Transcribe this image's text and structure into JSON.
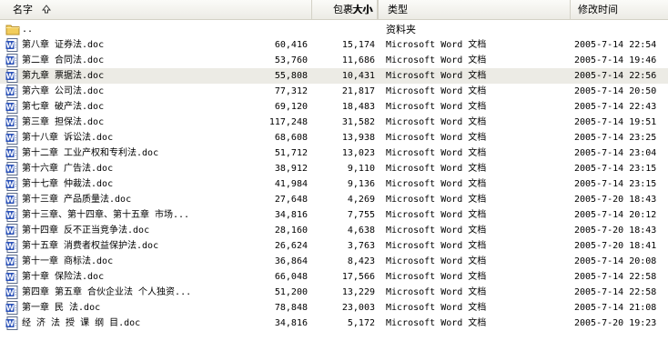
{
  "columns": {
    "name": "名字",
    "size": "大小",
    "packed_size": "包裹大小",
    "type": "类型",
    "modified": "修改时间"
  },
  "parent_row": {
    "name": "..",
    "type": "资料夹"
  },
  "files": [
    {
      "name": "第八章 证券法.doc",
      "size": "60,416",
      "packed": "15,174",
      "type": "Microsoft Word 文档",
      "date": "2005-7-14 22:54"
    },
    {
      "name": "第二章 合同法.doc",
      "size": "53,760",
      "packed": "11,686",
      "type": "Microsoft Word 文档",
      "date": "2005-7-14 19:46"
    },
    {
      "name": "第九章 票据法.doc",
      "size": "55,808",
      "packed": "10,431",
      "type": "Microsoft Word 文档",
      "date": "2005-7-14 22:56"
    },
    {
      "name": "第六章 公司法.doc",
      "size": "77,312",
      "packed": "21,817",
      "type": "Microsoft Word 文档",
      "date": "2005-7-14 20:50"
    },
    {
      "name": "第七章 破产法.doc",
      "size": "69,120",
      "packed": "18,483",
      "type": "Microsoft Word 文档",
      "date": "2005-7-14 22:43"
    },
    {
      "name": "第三章 担保法.doc",
      "size": "117,248",
      "packed": "31,582",
      "type": "Microsoft Word 文档",
      "date": "2005-7-14 19:51"
    },
    {
      "name": "第十八章 诉讼法.doc",
      "size": "68,608",
      "packed": "13,938",
      "type": "Microsoft Word 文档",
      "date": "2005-7-14 23:25"
    },
    {
      "name": "第十二章 工业产权和专利法.doc",
      "size": "51,712",
      "packed": "13,023",
      "type": "Microsoft Word 文档",
      "date": "2005-7-14 23:04"
    },
    {
      "name": "第十六章 广告法.doc",
      "size": "38,912",
      "packed": "9,110",
      "type": "Microsoft Word 文档",
      "date": "2005-7-14 23:15"
    },
    {
      "name": "第十七章 仲裁法.doc",
      "size": "41,984",
      "packed": "9,136",
      "type": "Microsoft Word 文档",
      "date": "2005-7-14 23:15"
    },
    {
      "name": "第十三章 产品质量法.doc",
      "size": "27,648",
      "packed": "4,269",
      "type": "Microsoft Word 文档",
      "date": "2005-7-20 18:43"
    },
    {
      "name": "第十三章、第十四章、第十五章 市场...",
      "size": "34,816",
      "packed": "7,755",
      "type": "Microsoft Word 文档",
      "date": "2005-7-14 20:12"
    },
    {
      "name": "第十四章 反不正当竞争法.doc",
      "size": "28,160",
      "packed": "4,638",
      "type": "Microsoft Word 文档",
      "date": "2005-7-20 18:43"
    },
    {
      "name": "第十五章 消费者权益保护法.doc",
      "size": "26,624",
      "packed": "3,763",
      "type": "Microsoft Word 文档",
      "date": "2005-7-20 18:41"
    },
    {
      "name": "第十一章 商标法.doc",
      "size": "36,864",
      "packed": "8,423",
      "type": "Microsoft Word 文档",
      "date": "2005-7-14 20:08"
    },
    {
      "name": "第十章 保险法.doc",
      "size": "66,048",
      "packed": "17,566",
      "type": "Microsoft Word 文档",
      "date": "2005-7-14 22:58"
    },
    {
      "name": "第四章 第五章 合伙企业法 个人独资...",
      "size": "51,200",
      "packed": "13,229",
      "type": "Microsoft Word 文档",
      "date": "2005-7-14 22:58"
    },
    {
      "name": "第一章 民 法.doc",
      "size": "78,848",
      "packed": "23,003",
      "type": "Microsoft Word 文档",
      "date": "2005-7-14 21:08"
    },
    {
      "name": "经 济 法 授 课 纲 目.doc",
      "size": "34,816",
      "packed": "5,172",
      "type": "Microsoft Word 文档",
      "date": "2005-7-20 19:23"
    }
  ],
  "selected_index": 2,
  "colors": {
    "word_icon_blue": "#2b52b8",
    "folder_yellow": "#f2cd5c",
    "selection_bg": "#ecebe5",
    "header_border": "#d3d1c6"
  }
}
